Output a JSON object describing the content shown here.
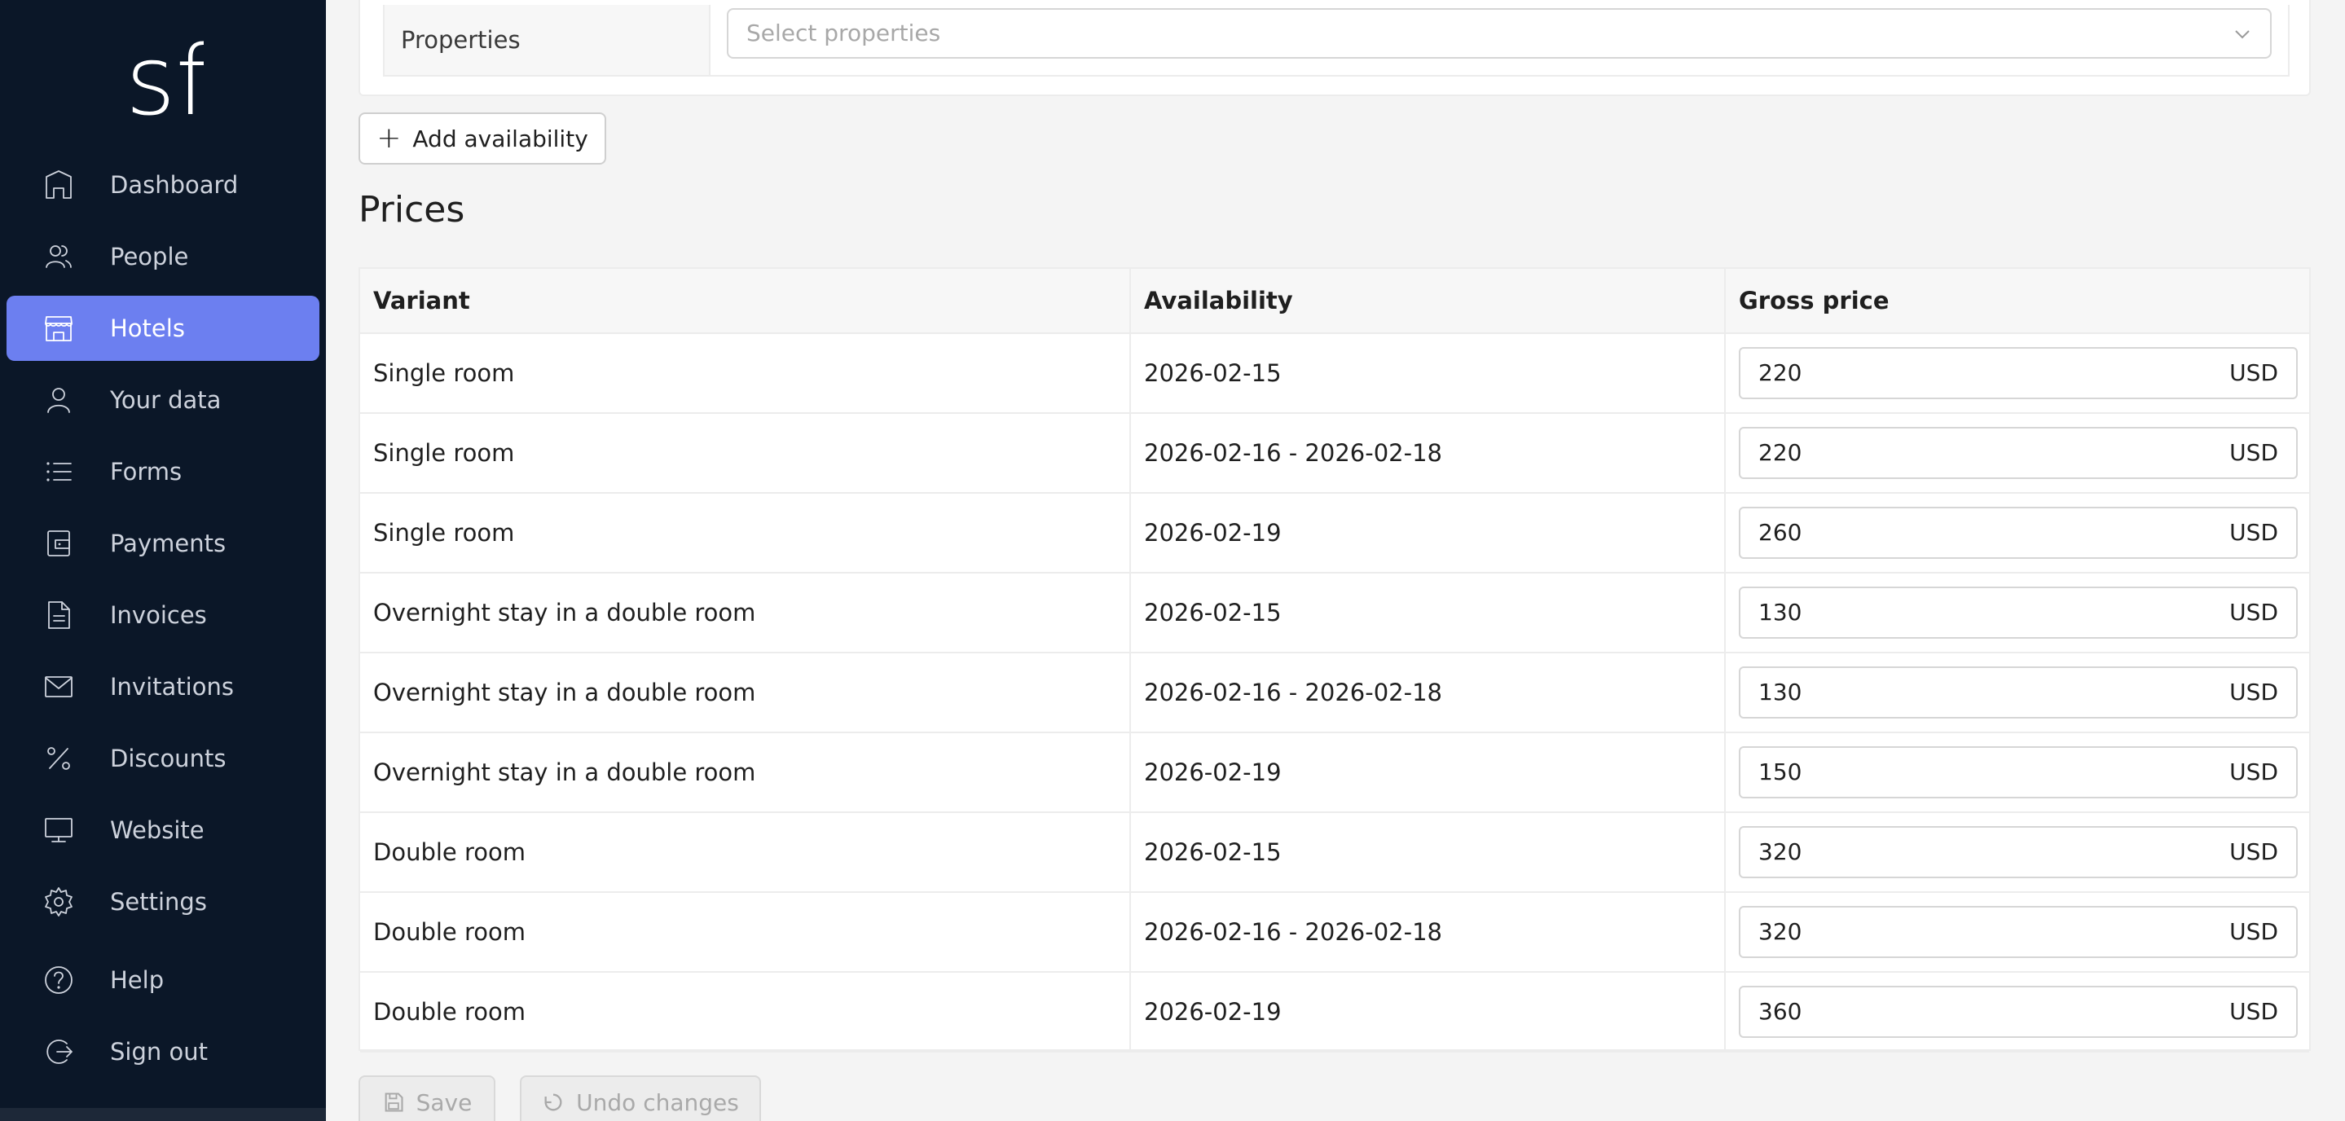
{
  "sidebar": {
    "logo_text": "sf",
    "items": [
      {
        "label": "Dashboard",
        "icon": "home-icon",
        "active": false
      },
      {
        "label": "People",
        "icon": "people-icon",
        "active": false
      },
      {
        "label": "Hotels",
        "icon": "hotel-icon",
        "active": true
      },
      {
        "label": "Your data",
        "icon": "user-icon",
        "active": false
      },
      {
        "label": "Forms",
        "icon": "list-icon",
        "active": false
      },
      {
        "label": "Payments",
        "icon": "wallet-icon",
        "active": false
      },
      {
        "label": "Invoices",
        "icon": "document-icon",
        "active": false
      },
      {
        "label": "Invitations",
        "icon": "mail-icon",
        "active": false
      },
      {
        "label": "Discounts",
        "icon": "percent-icon",
        "active": false
      },
      {
        "label": "Website",
        "icon": "monitor-icon",
        "active": false
      },
      {
        "label": "Settings",
        "icon": "gear-icon",
        "active": false
      },
      {
        "label": "Help",
        "icon": "help-icon",
        "active": false
      },
      {
        "label": "Sign out",
        "icon": "sign-out-icon",
        "active": false
      }
    ]
  },
  "colors": {
    "sidebar_bg": "#0b1728",
    "accent": "#6c7ff0",
    "page_bg": "#f4f4f4"
  },
  "properties": {
    "label": "Properties",
    "placeholder": "Select properties"
  },
  "add_availability_label": "Add availability",
  "prices": {
    "title": "Prices",
    "columns": [
      "Variant",
      "Availability",
      "Gross price"
    ],
    "rows": [
      {
        "variant": "Single room",
        "availability": "2026-02-15",
        "price": "220",
        "currency": "USD"
      },
      {
        "variant": "Single room",
        "availability": "2026-02-16 - 2026-02-18",
        "price": "220",
        "currency": "USD"
      },
      {
        "variant": "Single room",
        "availability": "2026-02-19",
        "price": "260",
        "currency": "USD"
      },
      {
        "variant": "Overnight stay in a double room",
        "availability": "2026-02-15",
        "price": "130",
        "currency": "USD"
      },
      {
        "variant": "Overnight stay in a double room",
        "availability": "2026-02-16 - 2026-02-18",
        "price": "130",
        "currency": "USD"
      },
      {
        "variant": "Overnight stay in a double room",
        "availability": "2026-02-19",
        "price": "150",
        "currency": "USD"
      },
      {
        "variant": "Double room",
        "availability": "2026-02-15",
        "price": "320",
        "currency": "USD"
      },
      {
        "variant": "Double room",
        "availability": "2026-02-16 - 2026-02-18",
        "price": "320",
        "currency": "USD"
      },
      {
        "variant": "Double room",
        "availability": "2026-02-19",
        "price": "360",
        "currency": "USD"
      }
    ]
  },
  "actions": {
    "save_label": "Save",
    "undo_label": "Undo changes"
  }
}
